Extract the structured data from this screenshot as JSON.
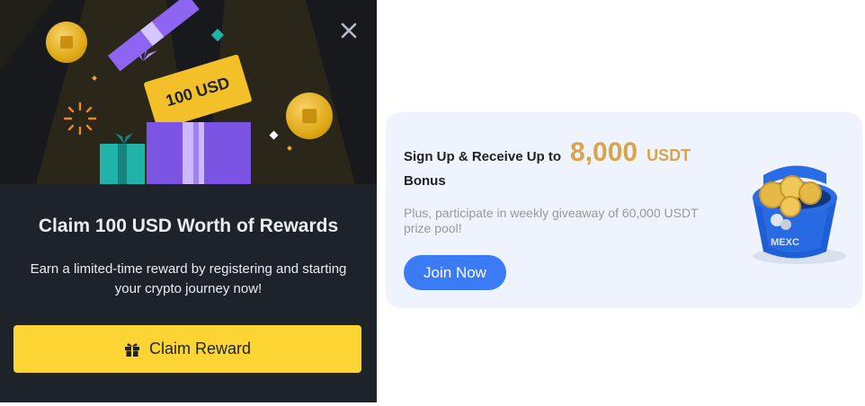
{
  "modal": {
    "voucher_text": "100 USD",
    "title": "Claim 100 USD Worth of Rewards",
    "description": "Earn a limited-time reward by registering and starting your crypto journey now!",
    "claim_button_label": "Claim Reward",
    "close_icon": "close-icon",
    "button_icon": "gift-icon",
    "colors": {
      "background": "#1e2329",
      "button": "#fcd535",
      "text": "#eaecef"
    }
  },
  "promo": {
    "headline": "Sign Up & Receive Up to",
    "amount": "8,000",
    "unit": "USDT",
    "bonus_label": "Bonus",
    "subtext": "Plus, participate in weekly giveaway of 60,000 USDT prize pool!",
    "join_button_label": "Join Now",
    "bucket_label": "MEXC",
    "colors": {
      "card_background": "#eef3fe",
      "amount": "#d9a54a",
      "button": "#3b7cf6"
    }
  }
}
